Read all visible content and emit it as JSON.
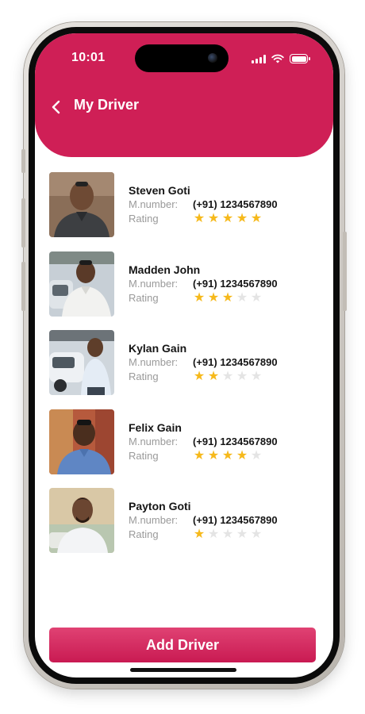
{
  "status_bar": {
    "time": "10:01"
  },
  "header": {
    "title": "My Driver",
    "back_icon": "chevron-left-icon",
    "background_color": "#cf1f56"
  },
  "labels": {
    "mobile": "M.number:",
    "rating": "Rating"
  },
  "drivers": [
    {
      "name": "Steven Goti",
      "mobile": "(+91) 1234567890",
      "rating": 5
    },
    {
      "name": "Madden John",
      "mobile": "(+91) 1234567890",
      "rating": 3
    },
    {
      "name": "Kylan Gain",
      "mobile": "(+91) 1234567890",
      "rating": 2
    },
    {
      "name": "Felix Gain",
      "mobile": "(+91) 1234567890",
      "rating": 4
    },
    {
      "name": "Payton Goti",
      "mobile": "(+91) 1234567890",
      "rating": 1
    }
  ],
  "max_rating": 5,
  "star_color": "#f6b91b",
  "footer": {
    "add_button_label": "Add Driver",
    "button_color": "#cf1f56"
  }
}
